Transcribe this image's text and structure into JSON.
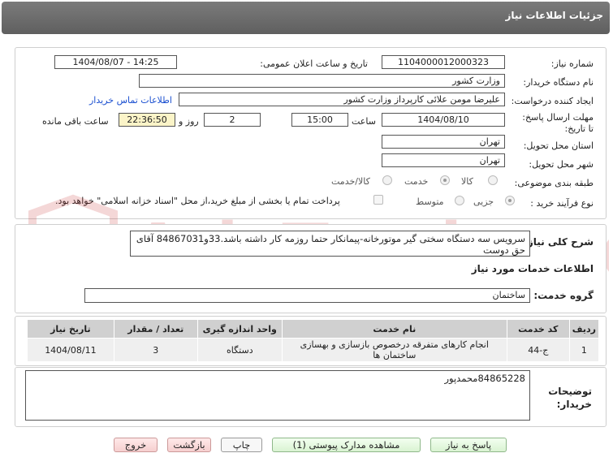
{
  "header": {
    "title": "جزئیات اطلاعات نیاز"
  },
  "form": {
    "need_number_label": "شماره نیاز:",
    "need_number": "1104000012000323",
    "announce_datetime_label": "تاریخ و ساعت اعلان عمومی:",
    "announce_datetime": "1404/08/07 - 14:25",
    "buyer_org_label": "نام دستگاه خریدار:",
    "buyer_org": "وزارت کشور",
    "requester_label": "ایجاد کننده درخواست:",
    "requester": "علیرضا مومن علائی کارپرداز وزارت کشور",
    "contact_link": "اطلاعات تماس خریدار",
    "deadline_label": "مهلت ارسال پاسخ: تا تاریخ:",
    "deadline_date": "1404/08/10",
    "time_label": "ساعت",
    "deadline_time": "15:00",
    "days_value": "2",
    "days_label": "روز و",
    "remaining_time": "22:36:50",
    "remaining_label": "ساعت باقی مانده",
    "province_label": "استان محل تحویل:",
    "province": "تهران",
    "city_label": "شهر محل تحویل:",
    "city": "تهران",
    "category_label": "طبقه بندی موضوعی:",
    "category_options": [
      "کالا",
      "خدمت",
      "کالا/خدمت"
    ],
    "category_selected": "خدمت",
    "process_label": "نوع فرآیند خرید :",
    "process_options": [
      "جزیی",
      "متوسط"
    ],
    "process_selected": "جزیی",
    "payment_note": "پرداخت تمام یا بخشی از مبلغ خرید،از محل \"اسناد خزانه اسلامی\" خواهد بود."
  },
  "description": {
    "label": "شرح کلی نیاز:",
    "text": "سرویس سه دستگاه سختی گیر موتورخانه-پیمانکار حتما روزمه کار داشته باشد.33و84867031 آقای حق دوست"
  },
  "services": {
    "section_title": "اطلاعات خدمات مورد نیاز",
    "group_label": "گروه خدمت:",
    "group_value": "ساختمان",
    "columns": [
      "ردیف",
      "کد خدمت",
      "نام خدمت",
      "واحد اندازه گیری",
      "تعداد / مقدار",
      "تاریخ نیاز"
    ],
    "rows": [
      {
        "row": "1",
        "code": "ج-44",
        "name": "انجام کارهای متفرقه درخصوص بازسازی و بهسازی ساختمان ها",
        "unit": "دستگاه",
        "qty": "3",
        "date": "1404/08/11"
      }
    ]
  },
  "buyer_notes": {
    "label": "توضیحات خریدار:",
    "text": "84865228محمدپور"
  },
  "buttons": {
    "reply": "پاسخ به نیاز",
    "attachments": "مشاهده مدارک پیوستی (1)",
    "print": "چاپ",
    "back": "بازگشت",
    "exit": "خروج"
  },
  "watermark": {
    "text": "AriaTender.net",
    "color": "#c62828"
  }
}
